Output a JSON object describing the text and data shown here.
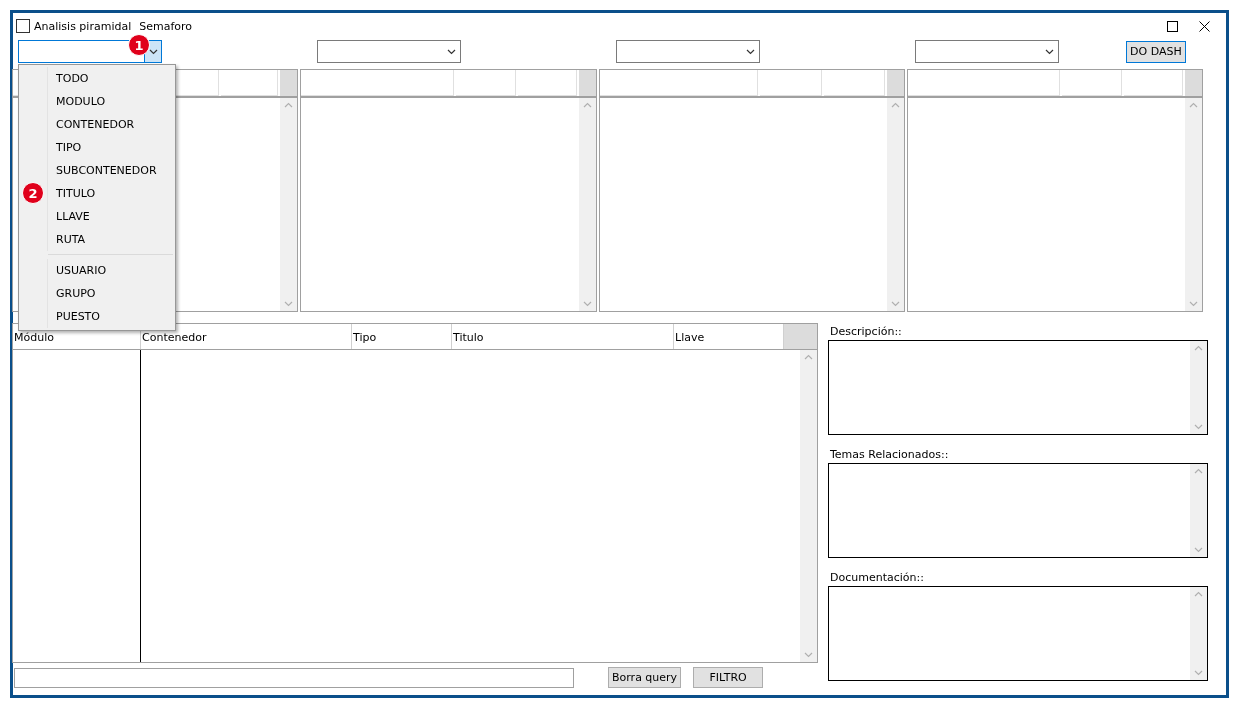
{
  "header": {
    "checkbox": {
      "label": "Analisis piramidal",
      "checked": false
    },
    "label": "Semaforo"
  },
  "combos": [
    {
      "open": true,
      "badge": "1"
    },
    {
      "open": false
    },
    {
      "open": false
    },
    {
      "open": false
    }
  ],
  "dash_button": "DO DASH",
  "dropdown": {
    "badge": "2",
    "groups": [
      {
        "items": [
          "TODO",
          "MODULO",
          "CONTENEDOR",
          "TIPO",
          "SUBCONTENEDOR",
          "TITULO",
          "LLAVE",
          "RUTA"
        ]
      },
      {
        "items": [
          "USUARIO",
          "GRUPO",
          "PUESTO"
        ]
      }
    ]
  },
  "results_table": {
    "columns": [
      "Módulo",
      "Contenedor",
      "Tipo",
      "Titulo",
      "Llave"
    ]
  },
  "detail_fields": [
    {
      "label": "Descripción::"
    },
    {
      "label": "Temas Relacionados::"
    },
    {
      "label": "Documentación::"
    }
  ],
  "footer": {
    "buttons": [
      "Borra query",
      "FILTRO"
    ]
  }
}
